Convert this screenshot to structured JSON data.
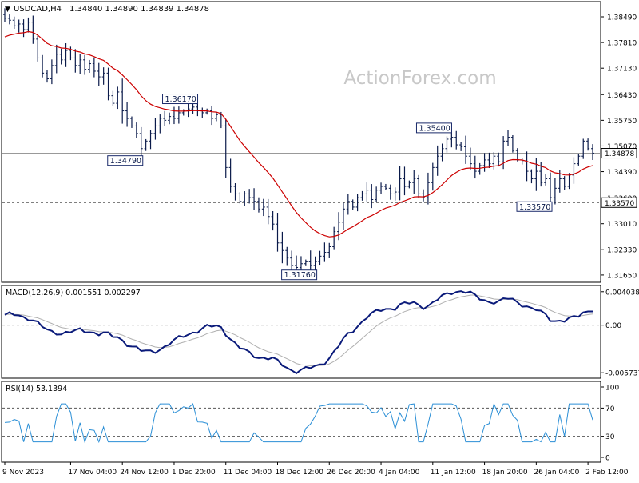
{
  "header": {
    "symbol_label": "USDCAD,H4",
    "ohlc": "1.34840 1.34890 1.34839 1.34878"
  },
  "watermark": "ActionForex.com",
  "colors": {
    "price_bar": "#0a1a4a",
    "moving_average": "#cc0000",
    "macd_line": "#0a1a7a",
    "signal_line": "#b0b0b0",
    "rsi_line": "#2b8fd6",
    "grid_dash": "#555555",
    "level_line": "#999999"
  },
  "chart_data": [
    {
      "type": "candlestick",
      "name": "price",
      "ylim": [
        1.315,
        1.3885
      ],
      "y_ticks": [
        "1.38490",
        "1.37810",
        "1.37130",
        "1.36430",
        "1.35750",
        "1.35070",
        "1.34390",
        "1.33690",
        "1.33010",
        "1.32330",
        "1.31650"
      ],
      "current_price": "1.34878",
      "horizontal_levels": [
        {
          "value": 1.34878,
          "style": "solid"
        },
        {
          "value": 1.3357,
          "style": "dashed",
          "label": "1.33570"
        }
      ],
      "annotations": [
        {
          "label": "1.34790",
          "bar": 29,
          "value": 1.3479
        },
        {
          "label": "1.36170",
          "bar": 40,
          "value": 1.3617
        },
        {
          "label": "1.31760",
          "bar": 66,
          "value": 1.3176
        },
        {
          "label": "1.35400",
          "bar": 94,
          "value": 1.354
        },
        {
          "label": "1.33570",
          "bar": 116,
          "value": 1.3357
        }
      ],
      "x_labels": [
        {
          "label": "9 Nov 2023",
          "bar": 0
        },
        {
          "label": "17 Nov 04:00",
          "bar": 14
        },
        {
          "label": "24 Nov 12:00",
          "bar": 25
        },
        {
          "label": "1 Dec 20:00",
          "bar": 36
        },
        {
          "label": "11 Dec 04:00",
          "bar": 47
        },
        {
          "label": "18 Dec 12:00",
          "bar": 58
        },
        {
          "label": "26 Dec 20:00",
          "bar": 69
        },
        {
          "label": "4 Jan 04:00",
          "bar": 80
        },
        {
          "label": "11 Jan 12:00",
          "bar": 91
        },
        {
          "label": "18 Jan 20:00",
          "bar": 102
        },
        {
          "label": "26 Jan 04:00",
          "bar": 113
        },
        {
          "label": "2 Feb 12:00",
          "bar": 124
        }
      ],
      "close": [
        1.3845,
        1.384,
        1.3825,
        1.383,
        1.3815,
        1.3835,
        1.379,
        1.374,
        1.37,
        1.3685,
        1.372,
        1.375,
        1.3735,
        1.376,
        1.374,
        1.372,
        1.3735,
        1.371,
        1.3725,
        1.3705,
        1.369,
        1.37,
        1.364,
        1.362,
        1.365,
        1.36,
        1.358,
        1.356,
        1.354,
        1.35,
        1.352,
        1.354,
        1.356,
        1.358,
        1.3575,
        1.3585,
        1.358,
        1.3595,
        1.36,
        1.3605,
        1.361,
        1.36,
        1.3595,
        1.36,
        1.358,
        1.359,
        1.356,
        1.345,
        1.34,
        1.338,
        1.336,
        1.338,
        1.337,
        1.336,
        1.334,
        1.3345,
        1.332,
        1.33,
        1.325,
        1.323,
        1.321,
        1.319,
        1.3185,
        1.3195,
        1.32,
        1.319,
        1.32,
        1.3215,
        1.3225,
        1.324,
        1.328,
        1.3305,
        1.334,
        1.336,
        1.3345,
        1.337,
        1.338,
        1.339,
        1.3365,
        1.339,
        1.34,
        1.3395,
        1.338,
        1.3385,
        1.342,
        1.34,
        1.341,
        1.342,
        1.338,
        1.337,
        1.341,
        1.345,
        1.348,
        1.35,
        1.3525,
        1.353,
        1.351,
        1.3505,
        1.348,
        1.346,
        1.344,
        1.3455,
        1.347,
        1.346,
        1.348,
        1.3465,
        1.352,
        1.353,
        1.3495,
        1.347,
        1.3465,
        1.344,
        1.342,
        1.344,
        1.341,
        1.342,
        1.337,
        1.3395,
        1.342,
        1.34,
        1.343,
        1.346,
        1.348,
        1.352,
        1.35,
        1.3488
      ],
      "moving_average_last": 1.3455,
      "macd": {
        "label": "MACD(12,26,9) 0.001551 0.002297",
        "y_ticks": [
          "0.004038",
          "0.00",
          "-0.005737"
        ],
        "ylim": [
          -0.0062,
          0.0045
        ]
      },
      "rsi": {
        "label": "RSI(14) 53.1394",
        "y_ticks": [
          "100",
          "70",
          "30",
          "0"
        ],
        "ylim": [
          0,
          100
        ],
        "levels": [
          70,
          30
        ]
      }
    }
  ]
}
